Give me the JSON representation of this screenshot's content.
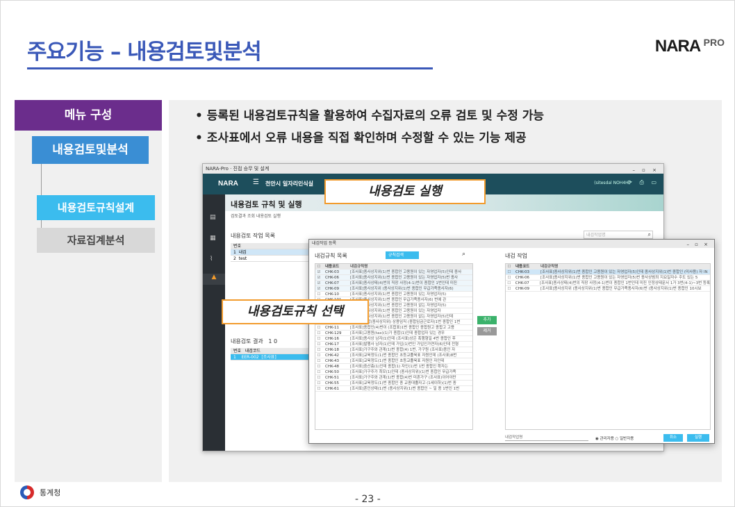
{
  "slide": {
    "title": "주요기능 – 내용검토및분석",
    "logo_brand": "NARA",
    "logo_pro": "PRO",
    "page_number": "- 23 -",
    "footer_org": "통계청",
    "accent_color": "#3a58b8"
  },
  "left_menu": {
    "header": "메뉴 구성",
    "item1": "내용검토및분석",
    "item2": "내용검토규칙설계",
    "item3": "자료집계분석"
  },
  "bullets": [
    "등록된 내용검토규칙을 활용하여 수집자료의 오류 검토 및 수정 가능",
    "조사표에서 오류 내용을 직접 확인하며 수정할 수 있는 기능 제공"
  ],
  "callouts": {
    "run": "내용검토 실행",
    "select": "내용검토규칙 선택"
  },
  "app": {
    "window_title": "NARA-Pro · 진접 승무 및 설계",
    "brand": "NARA",
    "org": "천안시 일자리인식실",
    "user": "(sitesdal NOH4H)",
    "section_title": "내용검토 규칙 및 실행",
    "sub_tabs": "검토결과 조회  내용검토 실행",
    "list_title": "내용검토 작업 목록",
    "search_placeholder": "내검작업명",
    "list_rows": [
      {
        "no": "번호",
        "name": ""
      },
      {
        "no": "1",
        "name": "내검"
      },
      {
        "no": "2",
        "name": "test"
      }
    ],
    "result_title": "내용검토 결과",
    "result_count": "1 0",
    "result_rows": [
      {
        "no": "번호",
        "code": "내검코드",
        "text": ""
      },
      {
        "no": "1",
        "code": "EER-002",
        "text": "[조사표]"
      }
    ]
  },
  "dialog": {
    "title": "내검작업 등록",
    "left_title": "내검규칙 목록",
    "dropdown": "규칙검색",
    "right_title": "내검 작업",
    "col_code": "내용코드",
    "col_desc": "내검규칙명",
    "btn_add": "추가",
    "btn_remove": "제거",
    "work_name_placeholder": "내검작업명",
    "radio_label": "◉ 관리자용  ○ 일반자용",
    "btn_cancel": "취소",
    "btn_save": "실행",
    "rules": [
      {
        "code": "CHK-03",
        "desc": "[조사표]종사상지위(1)번 종합인 고용원이 있는 자영업자(5)인데 종사",
        "checked": true
      },
      {
        "code": "CHK-06",
        "desc": "[조사표]종사상지위(1)번 종합인 고용원이 있는 자영업자(5)번 종사",
        "checked": true
      },
      {
        "code": "CHK-07",
        "desc": "[조사표]종사상태(4)번의 직장 사정(4-1)번이 종합인 1번인데 미진",
        "checked": true
      },
      {
        "code": "CHK-09",
        "desc": "[조사표]종사상지위 (종사상지위(1)번 종합인 무급가족종사자(6)",
        "checked": true
      },
      {
        "code": "CHK-10",
        "desc": "[조사표]종사상지위(1)번 종합인 고용원이 있는 자영업자(5)",
        "checked": false
      },
      {
        "code": "CHK-101",
        "desc": "[조사표]종사상지위(1)번 종합인 무급가족종사자(6) 번에 관",
        "checked": false
      },
      {
        "code": "CHK-102",
        "desc": "[조사표]종사상지위(1)번 종합인 고용원이 없는 자영업자(5)",
        "checked": false
      },
      {
        "code": "CHK-103",
        "desc": "[조사표]종사상지위(1)번 종합인 고용원이 있는 자영업자",
        "checked": false
      },
      {
        "code": "CHK-104",
        "desc": "[조사표]종사상지위(1)번 종합인 고용원이 없는 자영업자(5)인데",
        "checked": false
      },
      {
        "code": "CHK-108",
        "desc": "[조사표]종합(종사상지위) 상용임직 (종합임금근로자)1번 종합인 1번",
        "checked": false
      },
      {
        "code": "CHK-11",
        "desc": "[조사표]종합인(4)번이 (조합표)1번 종합인 종합원고 종합고 고용",
        "checked": false
      },
      {
        "code": "CHK-129",
        "desc": "[조사표]고용원(tax)(1)가 종합(1)인데 종합업자 있는 경우",
        "checked": false
      },
      {
        "code": "CHK-16",
        "desc": "[조사표]종사상 남자(1)인데 (조사표)상은 폭행형일 4번 종합인 후",
        "checked": false
      },
      {
        "code": "CHK-17",
        "desc": "[조사표]발행사 남자(1)인데 가입(1)번인 가입인가연자(6)인데 전형",
        "checked": false
      },
      {
        "code": "CHK-18",
        "desc": "[조사표]가구주와 관계(1)번 종합(4) 1번, 가구원 (조사표)종인 자",
        "checked": false
      },
      {
        "code": "CHK-42",
        "desc": "[조사표]교육정도(1)번 종합인 초등교졸육표 자원인데 (조사표)8번",
        "checked": false
      },
      {
        "code": "CHK-43",
        "desc": "[조사표]교육정도(1)번 종합인 초등교졸육표 자원인 자인데",
        "checked": false
      },
      {
        "code": "CHK-48",
        "desc": "[조사표]중산층(1)인데 종합(1) 자인(1)번 1번 종합인 확자는",
        "checked": false
      },
      {
        "code": "CHK-50",
        "desc": "[조사표]가구주가 최모(1)인데 (종사상지위)(1)번 종합인 무급가족",
        "checked": false
      },
      {
        "code": "CHK-51",
        "desc": "[조사표]가구주와 관계(1)번 종합(4)번 미혼가구 (조사표)이어야만",
        "checked": false
      },
      {
        "code": "CHK-55",
        "desc": "[조사표]교육정도(1)번 종합인 종 교종대졸자고 (1세이하)(1)번 종",
        "checked": false
      },
      {
        "code": "CHK-61",
        "desc": "[조사표]혼인상태(1)번 (종사상지위(1)번 종합인 ~ 일 종 1번인 1번",
        "checked": false
      }
    ],
    "selected": [
      {
        "code": "CHK-03",
        "desc": "[조사표]종사상지위(1)번 종합인 고용원이 있는 자영업자(5)인데 종사상지위(1)번 종합인 (미사용) 자 IN"
      },
      {
        "code": "CHK-06",
        "desc": "[조사표]종사상지위(1)번 종합인 고용원이 있는 자영업자(5)번 종사상범죄 지요일자수 주도 있는 5"
      },
      {
        "code": "CHK-07",
        "desc": "[조사표]종사상태(4)번의 직장 사정(4-1)번이 종합인 1번인데 미진 인정상태문서 1가 3번(4-1)~3번 등록"
      },
      {
        "code": "CHK-09",
        "desc": "[조사표]종사상지위 (종사상지위(1)번 종합인 무급가족종사자(6)번 (종사상지위(1)번 종합인 10시보"
      }
    ]
  }
}
